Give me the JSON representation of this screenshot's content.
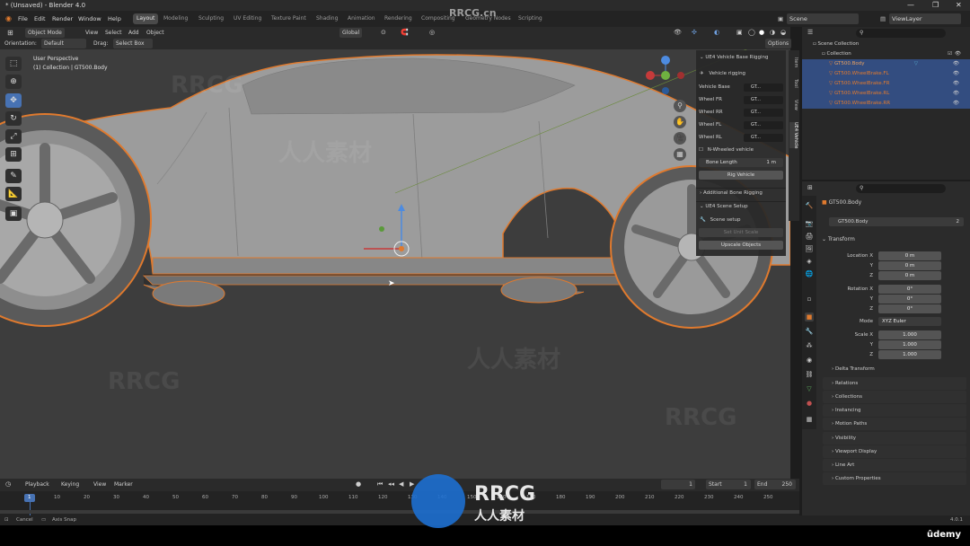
{
  "window": {
    "title": "* (Unsaved) - Blender 4.0",
    "controls": [
      "—",
      "❐",
      "✕"
    ]
  },
  "menu": [
    "File",
    "Edit",
    "Render",
    "Window",
    "Help"
  ],
  "workspaces": [
    "Layout",
    "Modeling",
    "Sculpting",
    "UV Editing",
    "Texture Paint",
    "Shading",
    "Animation",
    "Rendering",
    "Compositing",
    "Geometry Nodes",
    "Scripting"
  ],
  "active_workspace": "Layout",
  "scene": {
    "label": "Scene",
    "view_layer": "ViewLayer"
  },
  "viewport_header": {
    "mode": "Object Mode",
    "menus": [
      "View",
      "Select",
      "Add",
      "Object"
    ],
    "transform": "Global",
    "orientation_label": "Orientation:",
    "orientation_value": "Default",
    "drag_label": "Drag:",
    "drag_value": "Select Box",
    "options": "Options"
  },
  "viewport_info": {
    "line1": "User Perspective",
    "line2": "(1) Collection | GT500.Body"
  },
  "npanel": {
    "section1": "UE4 Vehicle Base Rigging",
    "rigging_label": "Vehicle rigging",
    "fields": [
      {
        "label": "Vehicle Base",
        "value": "GT..."
      },
      {
        "label": "Wheel FR",
        "value": "GT..."
      },
      {
        "label": "Wheel RR",
        "value": "GT..."
      },
      {
        "label": "Wheel FL",
        "value": "GT..."
      },
      {
        "label": "Wheel RL",
        "value": "GT..."
      }
    ],
    "n_wheeled": "N-Wheeled vehicle",
    "bone_length_label": "Bone Length",
    "bone_length_value": "1 m",
    "rig_vehicle": "Rig Vehicle",
    "section2": "Additional Bone Rigging",
    "section3": "UE4 Scene Setup",
    "scene_setup": "Scene setup",
    "set_unit_scale": "Set Unit Scale",
    "upscale_objects": "Upscale Objects",
    "tabs": [
      "Item",
      "Tool",
      "View",
      "UE4 Vehicle"
    ]
  },
  "outliner": {
    "root": "Scene Collection",
    "collection": "Collection",
    "items": [
      "GT500.Body",
      "GT500.WheelBrake.FL",
      "GT500.WheelBrake.FR",
      "GT500.WheelBrake.RL",
      "GT500.WheelBrake.RR"
    ]
  },
  "properties": {
    "object_name": "GT500.Body",
    "mesh_name": "GT500.Body",
    "users": "2",
    "transform_label": "Transform",
    "location_label": "Location X",
    "location": [
      "0 m",
      "0 m",
      "0 m"
    ],
    "rotation_label": "Rotation X",
    "rotation": [
      "0°",
      "0°",
      "0°"
    ],
    "mode_label": "Mode",
    "mode_value": "XYZ Euler",
    "scale_label": "Scale X",
    "scale": [
      "1.000",
      "1.000",
      "1.000"
    ],
    "axis_y": "Y",
    "axis_z": "Z",
    "delta": "Delta Transform",
    "sections": [
      "Relations",
      "Collections",
      "Instancing",
      "Motion Paths",
      "Visibility",
      "Viewport Display",
      "Line Art",
      "Custom Properties"
    ]
  },
  "timeline": {
    "menus": [
      "Playback",
      "Keying",
      "View",
      "Marker"
    ],
    "current_frame": "1",
    "start_label": "Start",
    "start": "1",
    "end_label": "End",
    "end": "250",
    "ticks": [
      "1",
      "10",
      "20",
      "30",
      "40",
      "50",
      "60",
      "70",
      "80",
      "90",
      "100",
      "110",
      "120",
      "130",
      "140",
      "150",
      "160",
      "170",
      "180",
      "190",
      "200",
      "210",
      "220",
      "230",
      "240",
      "250"
    ]
  },
  "status": {
    "cancel": "Cancel",
    "axis_snap": "Axis Snap",
    "version": "4.0.1"
  },
  "watermark": {
    "brand": "RRCG",
    "sub": "人人素材",
    "site": "RRCG.cn",
    "udemy": "ûdemy"
  },
  "colors": {
    "accent": "#4772b3",
    "selection": "#334d80",
    "orange": "#e07a2e",
    "viewport": "#3d3d3d"
  }
}
